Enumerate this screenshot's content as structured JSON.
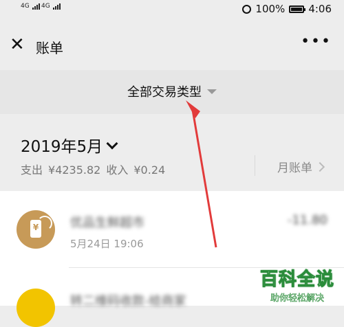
{
  "status": {
    "sim1": "4G",
    "sim2": "4G",
    "battery": "100%",
    "time": "4:06"
  },
  "header": {
    "close_icon": "close-icon",
    "title": "账单",
    "more_icon": "more-icon"
  },
  "filter": {
    "label": "全部交易类型"
  },
  "month": {
    "label": "2019年5月",
    "summary_expense_label": "支出",
    "summary_expense": "¥4235.82",
    "summary_income_label": "收入",
    "summary_income": "¥0.24",
    "monthly_bill": "月账单"
  },
  "transactions": [
    {
      "merchant": "优品生鲜超市",
      "amount": "-11.80",
      "time": "5月24日 19:06",
      "icon": "payment-code-icon"
    },
    {
      "merchant": "转二维码收款-给商家",
      "icon": "money-bag-icon"
    }
  ],
  "watermark": {
    "main": "百科全说",
    "sub": "助你轻松解决"
  },
  "colors": {
    "background": "#ededed",
    "avatar1": "#c79a58",
    "avatar2": "#f2c400",
    "arrow": "#e23b3b"
  }
}
